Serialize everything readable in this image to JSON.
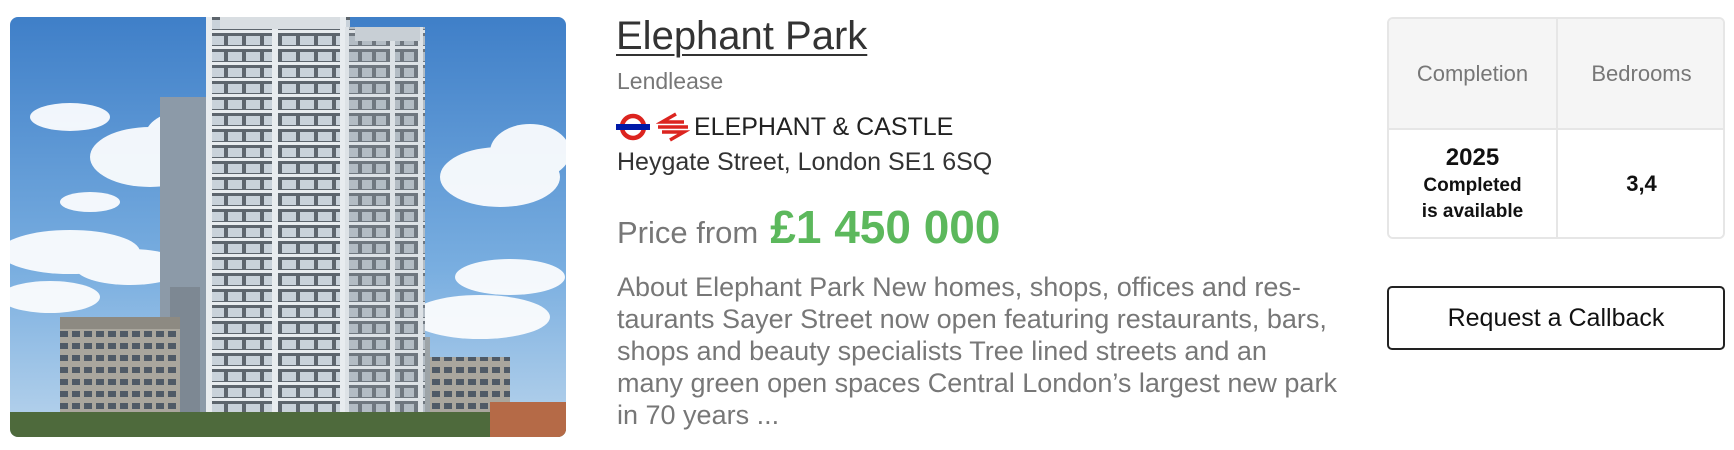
{
  "listing": {
    "title": "Elephant Park",
    "developer": "Lendlease",
    "station": {
      "name": "ELEPHANT & CASTLE",
      "icons": [
        "london-underground-roundel-icon",
        "national-rail-icon"
      ]
    },
    "address": "Heygate Street, London SE1 6SQ",
    "price_label": "Price from",
    "price_value": "£1 450 000",
    "description_lines": [
      "About Elephant Park New homes, shops, offices and res-",
      "taurants Sayer Street now open featuring restaurants, bars,",
      "shops and beauty specialists Tree lined streets and an",
      "many green open spaces Central London’s largest new park",
      "in 70 years ..."
    ]
  },
  "info_table": {
    "headers": [
      "Completion",
      "Bedrooms"
    ],
    "completion_year": "2025",
    "completion_status_line1": "Completed",
    "completion_status_line2": "is available",
    "bedrooms": "3,4"
  },
  "callback_button_label": "Request a Callback",
  "colors": {
    "price_accent": "#5cb85c",
    "muted_text": "#777777",
    "underground_red": "#dc241f",
    "underground_blue": "#0019a8",
    "rail_red": "#dc241f"
  }
}
